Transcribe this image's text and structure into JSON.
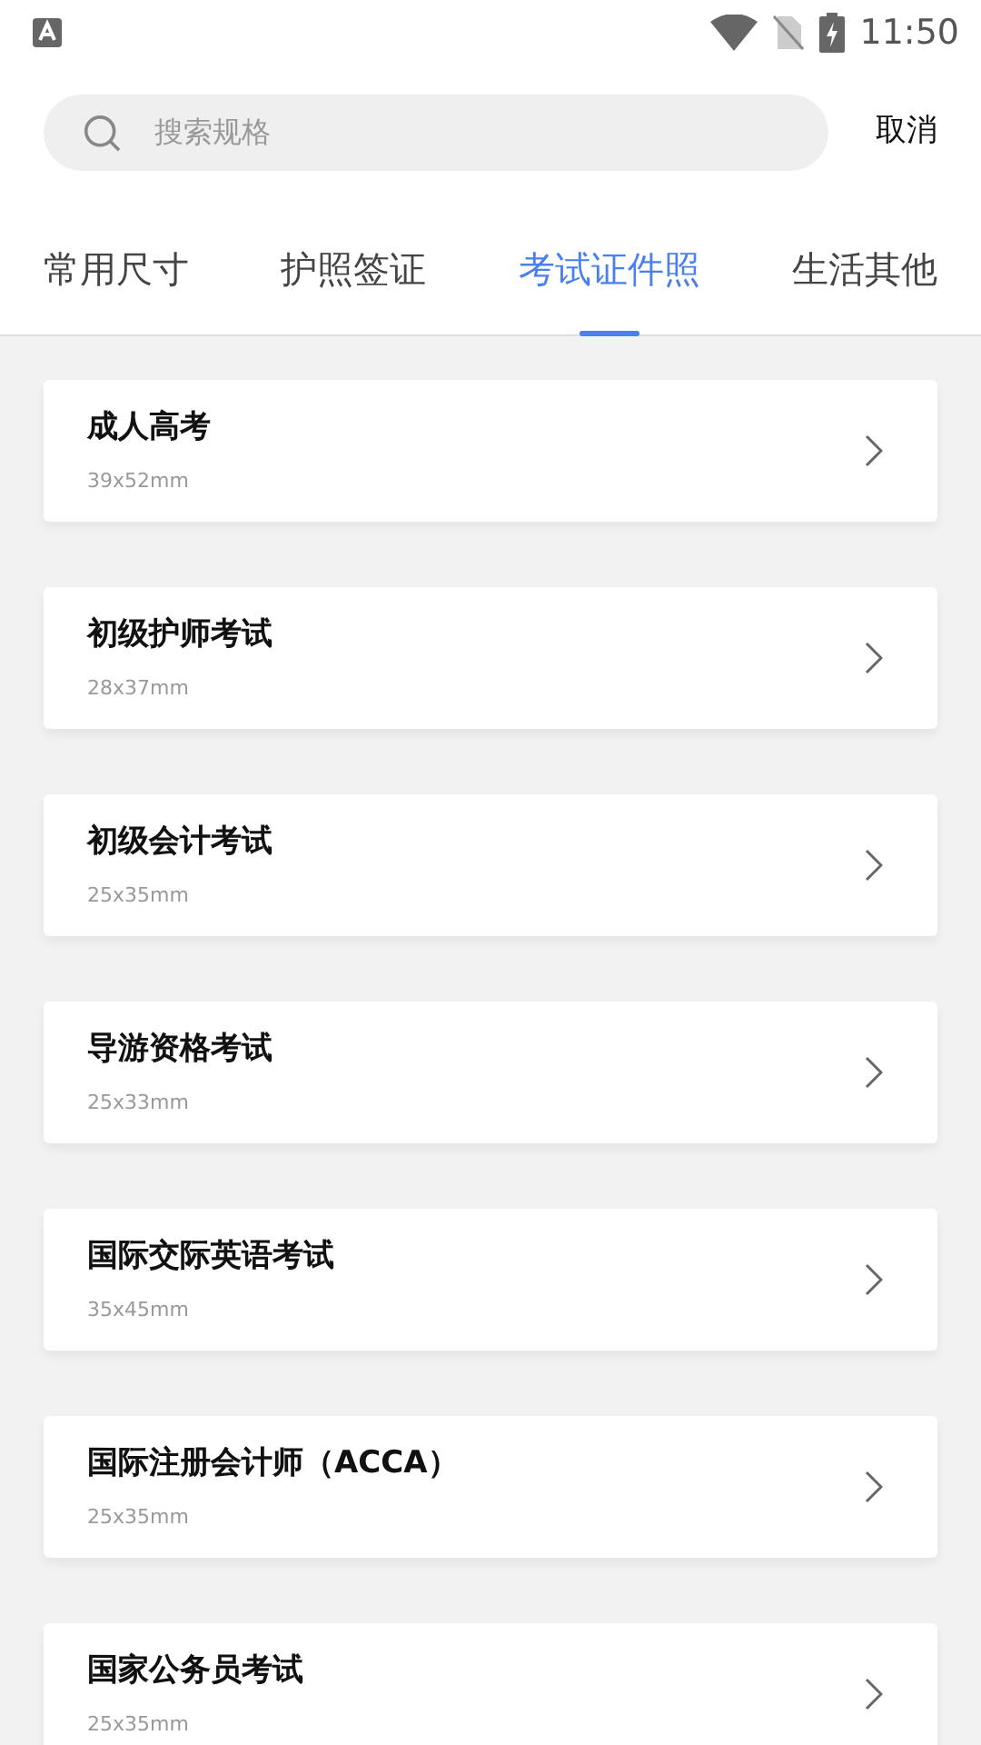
{
  "status_bar": {
    "time": "11:50"
  },
  "search": {
    "placeholder": "搜索规格",
    "cancel": "取消"
  },
  "tabs": [
    {
      "label": "常用尺寸",
      "selected": false
    },
    {
      "label": "护照签证",
      "selected": false
    },
    {
      "label": "考试证件照",
      "selected": true
    },
    {
      "label": "生活其他",
      "selected": false
    }
  ],
  "items": [
    {
      "title": "成人高考",
      "size": "39x52mm"
    },
    {
      "title": "初级护师考试",
      "size": "28x37mm"
    },
    {
      "title": "初级会计考试",
      "size": "25x35mm"
    },
    {
      "title": "导游资格考试",
      "size": "25x33mm"
    },
    {
      "title": "国际交际英语考试",
      "size": "35x45mm"
    },
    {
      "title": "国际注册会计师（ACCA）",
      "size": "25x35mm"
    },
    {
      "title": "国家公务员考试",
      "size": "25x35mm"
    }
  ]
}
